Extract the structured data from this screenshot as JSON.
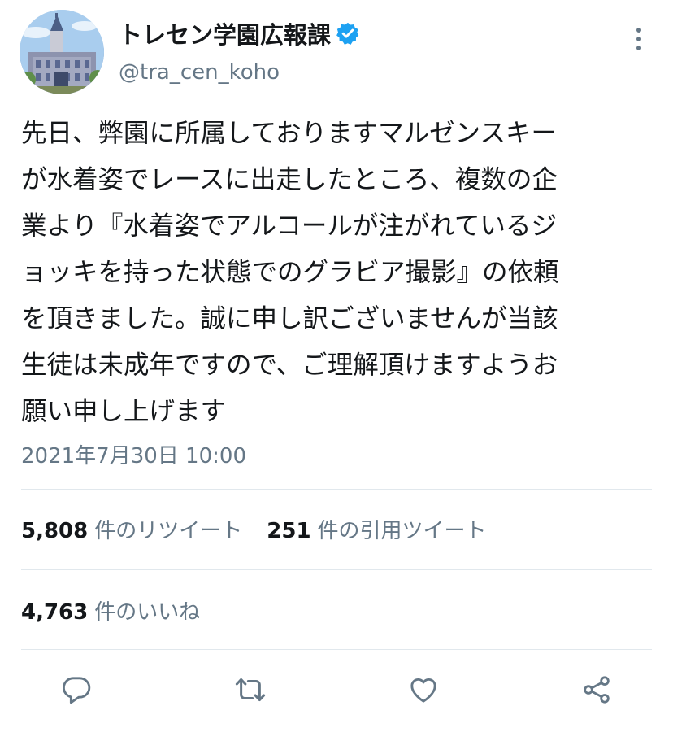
{
  "account": {
    "display_name": "トレセン学園広報課",
    "handle": "@tra_cen_koho",
    "verified": true
  },
  "tweet": {
    "lines": [
      "先日、弊園に所属しておりますマルゼンスキー",
      "が水着姿でレースに出走したところ、複数の企",
      "業より『水着姿でアルコールが注がれているジ",
      "ョッキを持った状態でのグラビア撮影』の依頼",
      "を頂きました。誠に申し訳ございませんが当該",
      "生徒は未成年ですので、ご理解頂けますようお",
      "願い申し上げます"
    ],
    "timestamp": "2021年7月30日 10:00"
  },
  "stats": {
    "retweets_count": "5,808",
    "retweets_label": "件のリツイート",
    "quotes_count": "251",
    "quotes_label": "件の引用ツイート",
    "likes_count": "4,763",
    "likes_label": "件のいいね"
  },
  "actions": [
    "reply-icon",
    "retweet-icon",
    "like-icon",
    "share-icon"
  ],
  "colors": {
    "text": "#14171a",
    "secondary": "#657786",
    "verified": "#1da1f2",
    "divider": "#e1e8ed"
  }
}
